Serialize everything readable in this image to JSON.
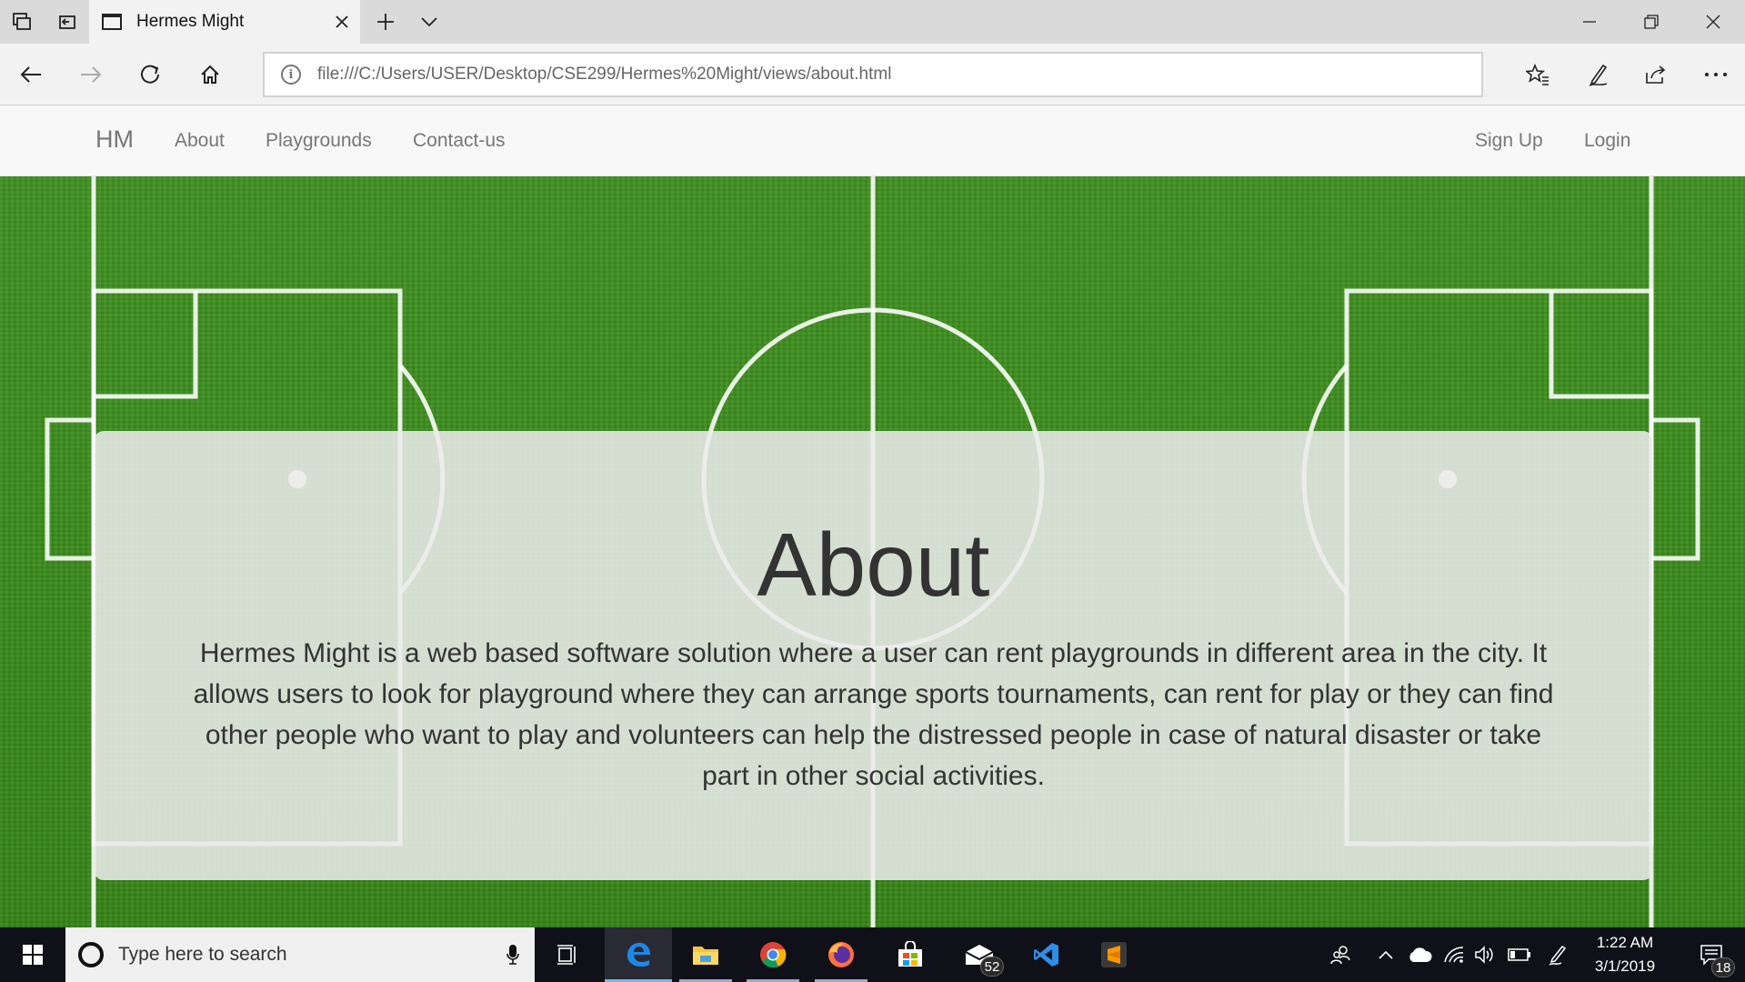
{
  "browser": {
    "tab_title": "Hermes Might",
    "url": "file:///C:/Users/USER/Desktop/CSE299/Hermes%20Might/views/about.html"
  },
  "site_nav": {
    "brand": "HM",
    "links": [
      "About",
      "Playgrounds",
      "Contact-us"
    ],
    "right_links": [
      "Sign Up",
      "Login"
    ]
  },
  "about": {
    "heading": "About",
    "body": "Hermes Might is a web based software solution where a user can rent playgrounds in different area in the city. It allows users to look for playground where they can arrange sports tournaments, can rent for play or they can find other people who want to play and volunteers can help the distressed people in case of natural disaster or take part in other social activities."
  },
  "taskbar": {
    "search_placeholder": "Type here to search",
    "mail_badge": "52",
    "time": "1:22 AM",
    "date": "3/1/2019",
    "notification_badge": "18"
  },
  "colors": {
    "field_green": "#3a8a1c",
    "panel": "#ececec",
    "edge_blue": "#1e88e5",
    "taskbar": "#101018"
  }
}
